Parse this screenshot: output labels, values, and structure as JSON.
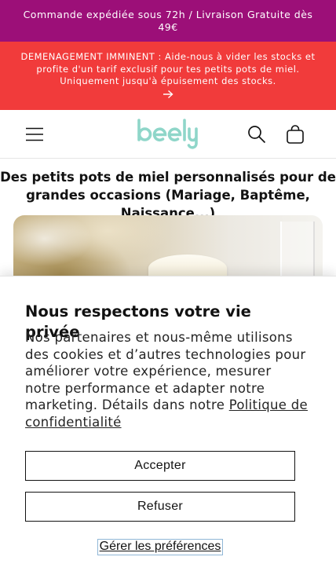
{
  "announcement_top": {
    "text": "Commande expédiée sous 72h / Livraison Gratuite dès 49€",
    "background": "#9c0f78"
  },
  "announcement_promo": {
    "text": "DEMENAGEMENT IMMINENT : Aide-nous à vider les stocks et profite d'un tarif exclusif pour tes petits pots de miel. Uniquement jusqu'à épuisement des stocks.",
    "background": "#f13b3b",
    "arrow_icon": "arrow-right-icon"
  },
  "header": {
    "logo_text": "beely",
    "logo_color": "#8fd6c9",
    "menu_icon": "hamburger-icon",
    "search_icon": "search-icon",
    "cart_icon": "cart-icon"
  },
  "main": {
    "title": "Des petits pots de miel personnalisés pour de grandes occasions (Mariage, Baptême, Naissance...)"
  },
  "consent": {
    "title": "Nous respectons votre vie privée",
    "body": "Nos partenaires et nous-même utilisons des cookies et d’autres technologies pour améliorer votre expérience, mesurer notre performance et adapter notre marketing. Détails dans notre",
    "policy_link": "Politique de confidentialité",
    "accept_label": "Accepter",
    "refuse_label": "Refuser",
    "preferences_label": "Gérer les préférences"
  }
}
